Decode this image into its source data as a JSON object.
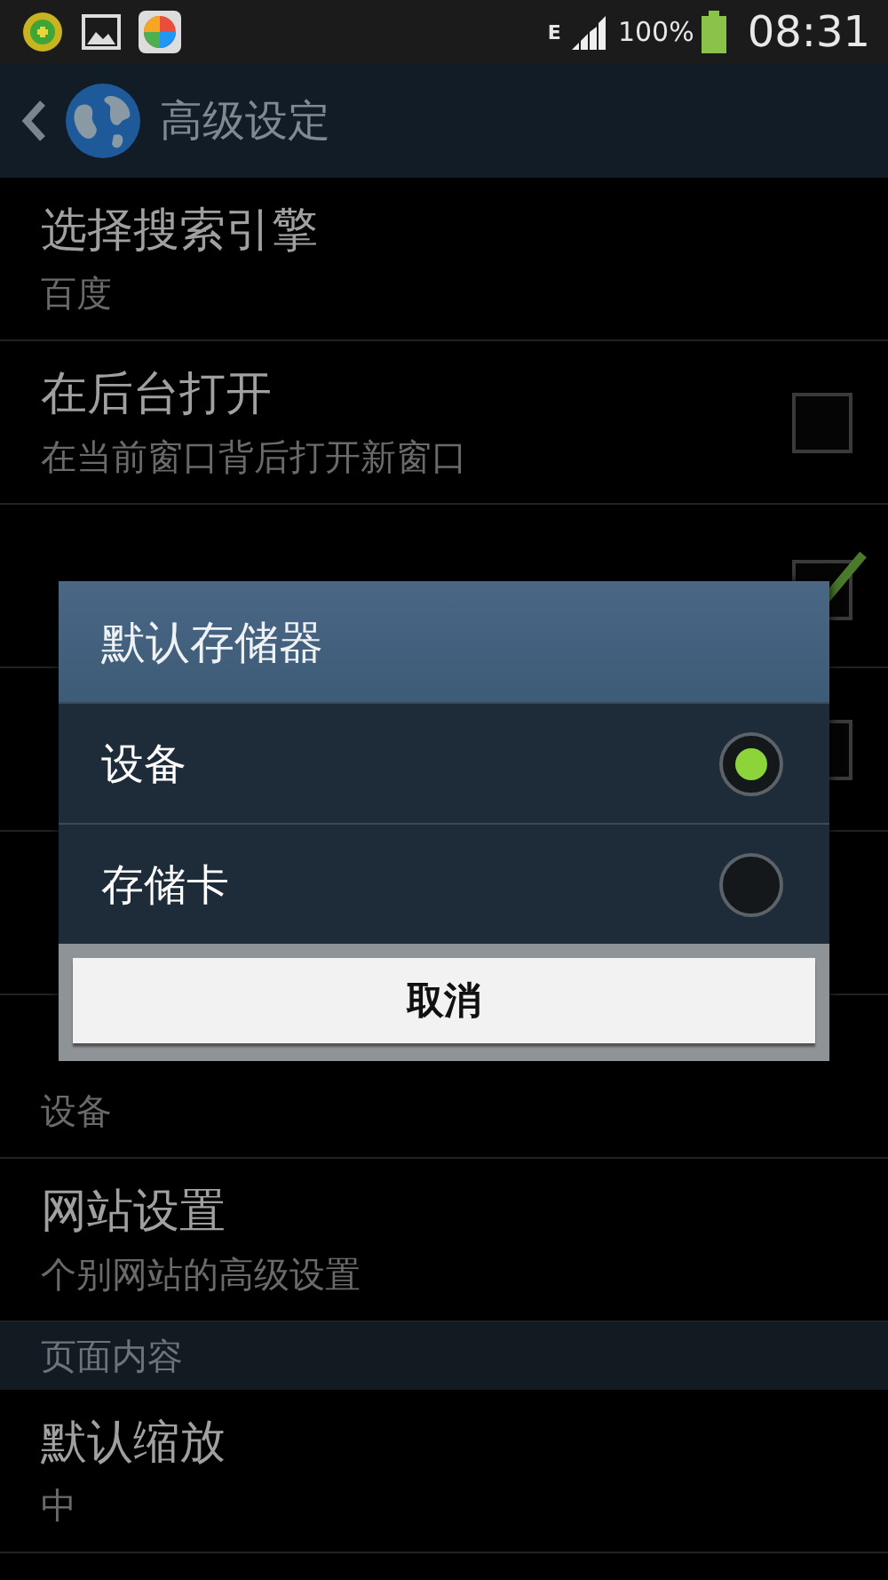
{
  "status_bar": {
    "network": "E",
    "battery": "100%",
    "time": "08:31"
  },
  "action_bar": {
    "title": "高级设定"
  },
  "rows": [
    {
      "kind": "text",
      "title": "选择搜索引擎",
      "summary": "百度"
    },
    {
      "kind": "checkbox",
      "title": "在后台打开",
      "summary": "在当前窗口背后打开新窗口",
      "checked": false
    },
    {
      "kind": "checkbox",
      "checked": true
    },
    {
      "kind": "checkbox",
      "checked": false
    },
    {
      "kind": "covered"
    },
    {
      "kind": "text",
      "summary": "设备"
    },
    {
      "kind": "text",
      "title": "网站设置",
      "summary": "个别网站的高级设置"
    },
    {
      "kind": "header",
      "title": "页面内容"
    },
    {
      "kind": "text",
      "title": "默认缩放",
      "summary": "中"
    }
  ],
  "dialog": {
    "title": "默认存储器",
    "options": [
      {
        "label": "设备",
        "selected": true
      },
      {
        "label": "存储卡",
        "selected": false
      }
    ],
    "cancel": "取消"
  }
}
